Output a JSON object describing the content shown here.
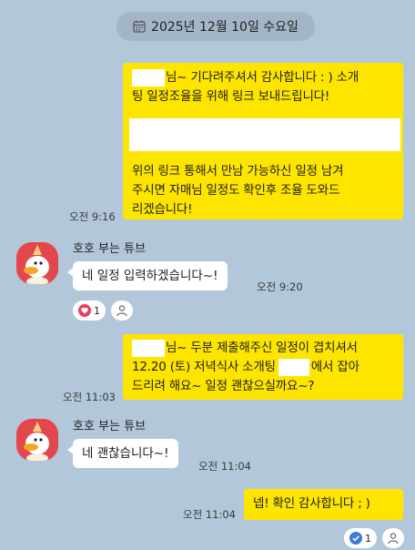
{
  "date_pill": {
    "icon": "calendar-icon",
    "label": "2025년 12월 10일 수요일"
  },
  "messages": [
    {
      "side": "right",
      "lines": [
        "님~ 기다려주셔서 감사합니다 : ) 소개",
        "팅 일정조율을 위해 링크 보내드립니다!",
        "위의 링크 통해서 만남 가능하신 일정 남겨",
        "주시면 자매님 일정도 확인후 조율 도와드",
        "리겠습니다!"
      ],
      "time": "오전 9:16"
    },
    {
      "side": "left",
      "sender": "호호 부는 튜브",
      "text": "네 일정 입력하겠습니다~!",
      "time": "오전 9:20",
      "reaction": {
        "icon": "heart-icon",
        "count": "1",
        "color": "#e8425a"
      }
    },
    {
      "side": "right",
      "lines": [
        "님~ 두분 제출해주신 일정이 겹치셔서",
        "12.20 (토) 저녁식사 소개팅",
        "에서 잡아",
        "드리려 해요~ 일정 괜찮으실까요~?"
      ],
      "time": "오전 11:03"
    },
    {
      "side": "left",
      "sender": "호호 부는 튜브",
      "text": "네 괜찮습니다~!",
      "time": "오전 11:04"
    },
    {
      "side": "right",
      "text": "넵! 확인 감사합니다 ; )",
      "time": "오전 11:04",
      "reaction": {
        "icon": "check-icon",
        "count": "1",
        "color": "#3a7bd5"
      }
    }
  ],
  "colors": {
    "background": "#b2c7da",
    "my_bubble": "#fee500",
    "their_bubble": "#ffffff"
  }
}
